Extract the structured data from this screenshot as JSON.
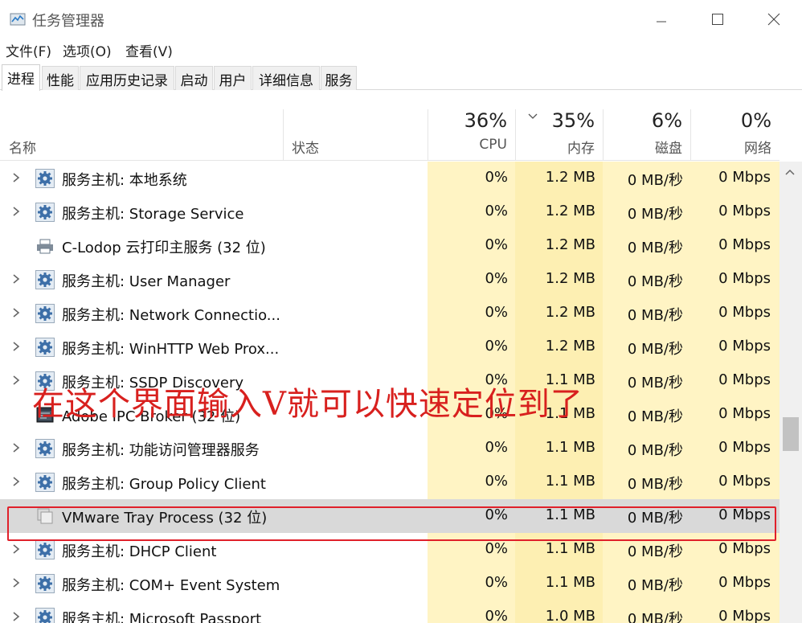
{
  "window": {
    "title": "任务管理器",
    "minimize_icon": "minimize-icon",
    "maximize_icon": "maximize-icon",
    "close_icon": "close-icon"
  },
  "menu": [
    "文件(F)",
    "选项(O)",
    "查看(V)"
  ],
  "tabs": [
    "进程",
    "性能",
    "应用历史记录",
    "启动",
    "用户",
    "详细信息",
    "服务"
  ],
  "active_tab": "进程",
  "columns": {
    "name": "名称",
    "status": "状态",
    "cpu": {
      "percent": "36%",
      "label": "CPU"
    },
    "memory": {
      "percent": "35%",
      "label": "内存"
    },
    "disk": {
      "percent": "6%",
      "label": "磁盘"
    },
    "network": {
      "percent": "0%",
      "label": "网络"
    }
  },
  "processes": [
    {
      "name": "服务主机: 本地系统",
      "icon": "gear-icon",
      "expandable": true,
      "cpu": "0%",
      "mem": "1.2 MB",
      "disk": "0 MB/秒",
      "net": "0 Mbps"
    },
    {
      "name": "服务主机: Storage Service",
      "icon": "gear-icon",
      "expandable": true,
      "cpu": "0%",
      "mem": "1.2 MB",
      "disk": "0 MB/秒",
      "net": "0 Mbps"
    },
    {
      "name": "C-Lodop 云打印主服务 (32 位)",
      "icon": "printer-icon",
      "expandable": false,
      "cpu": "0%",
      "mem": "1.2 MB",
      "disk": "0 MB/秒",
      "net": "0 Mbps"
    },
    {
      "name": "服务主机: User Manager",
      "icon": "gear-icon",
      "expandable": true,
      "cpu": "0%",
      "mem": "1.2 MB",
      "disk": "0 MB/秒",
      "net": "0 Mbps"
    },
    {
      "name": "服务主机: Network Connectio...",
      "icon": "gear-icon",
      "expandable": true,
      "cpu": "0%",
      "mem": "1.2 MB",
      "disk": "0 MB/秒",
      "net": "0 Mbps"
    },
    {
      "name": "服务主机: WinHTTP Web Prox...",
      "icon": "gear-icon",
      "expandable": true,
      "cpu": "0%",
      "mem": "1.2 MB",
      "disk": "0 MB/秒",
      "net": "0 Mbps"
    },
    {
      "name": "服务主机: SSDP Discovery",
      "icon": "gear-icon",
      "expandable": true,
      "cpu": "0%",
      "mem": "1.1 MB",
      "disk": "0 MB/秒",
      "net": "0 Mbps"
    },
    {
      "name": "Adobe IPC Broker (32 位)",
      "icon": "app-window-icon",
      "expandable": false,
      "cpu": "0%",
      "mem": "1.1 MB",
      "disk": "0 MB/秒",
      "net": "0 Mbps"
    },
    {
      "name": "服务主机: 功能访问管理器服务",
      "icon": "gear-icon",
      "expandable": true,
      "cpu": "0%",
      "mem": "1.1 MB",
      "disk": "0 MB/秒",
      "net": "0 Mbps"
    },
    {
      "name": "服务主机: Group Policy Client",
      "icon": "gear-icon",
      "expandable": true,
      "cpu": "0%",
      "mem": "1.1 MB",
      "disk": "0 MB/秒",
      "net": "0 Mbps"
    },
    {
      "name": "VMware Tray Process (32 位)",
      "icon": "blank-window-icon",
      "expandable": false,
      "selected": true,
      "cpu": "0%",
      "mem": "1.1 MB",
      "disk": "0 MB/秒",
      "net": "0 Mbps"
    },
    {
      "name": "服务主机: DHCP Client",
      "icon": "gear-icon",
      "expandable": true,
      "cpu": "0%",
      "mem": "1.1 MB",
      "disk": "0 MB/秒",
      "net": "0 Mbps"
    },
    {
      "name": "服务主机: COM+ Event System",
      "icon": "gear-icon",
      "expandable": true,
      "cpu": "0%",
      "mem": "1.1 MB",
      "disk": "0 MB/秒",
      "net": "0 Mbps"
    },
    {
      "name": "服务主机: Microsoft Passport",
      "icon": "gear-icon",
      "expandable": true,
      "cpu": "0%",
      "mem": "1.0 MB",
      "disk": "0 MB/秒",
      "net": "0 Mbps"
    }
  ],
  "annotation": "在这个界面输入V就可以快速定位到了",
  "colors": {
    "cpu_bg": "#fff4c4",
    "mem_bg": "#fdefb2",
    "selection": "#d9d9d9",
    "annotation": "#d8201e"
  }
}
